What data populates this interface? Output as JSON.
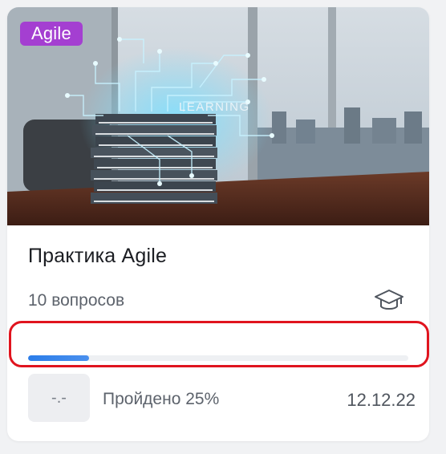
{
  "card": {
    "category_tag": "Agile",
    "hero_image_text": "LEARNING",
    "title": "Практика Agile",
    "questions_count": "10 вопросов",
    "progress_percent": 25,
    "score_placeholder": "-.-",
    "passed_text": "Пройдено 25%",
    "date": "12.12.22"
  },
  "colors": {
    "tag_bg": "#a43fd1",
    "progress_fill": "#2b7de9",
    "highlight_border": "#e0141e"
  },
  "icons": {
    "course": "graduation-cap-icon"
  }
}
